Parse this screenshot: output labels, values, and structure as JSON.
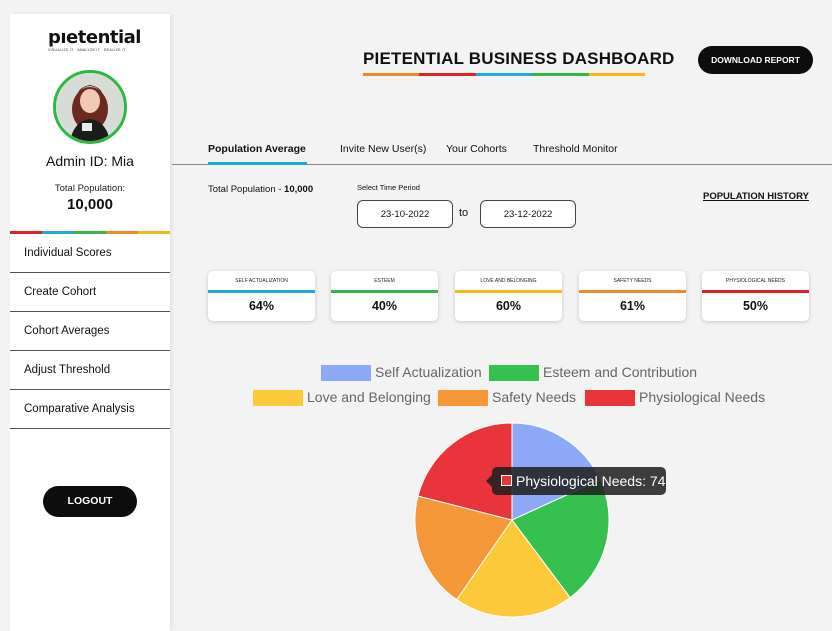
{
  "sidebar": {
    "logo": "pıetential",
    "tagline": "VISUALIZE IT · ANALYZE IT · REALIZE IT",
    "admin_id": "Admin ID: Mia",
    "total_population_label": "Total Population:",
    "total_population_value": "10,000",
    "nav": [
      "Individual Scores",
      "Create Cohort",
      "Cohort Averages",
      "Adjust Threshold",
      "Comparative Analysis"
    ],
    "logout_label": "LOGOUT"
  },
  "header": {
    "title": "PIETENTIAL BUSINESS DASHBOARD",
    "download_label": "DOWNLOAD REPORT"
  },
  "tabs": [
    "Population Average",
    "Invite New User(s)",
    "Your Cohorts",
    "Threshold Monitor"
  ],
  "filters": {
    "total_population_prefix": "Total Population - ",
    "total_population_value": "10,000",
    "time_period_label": "Select Time Period",
    "start_date": "23-10-2022",
    "to_label": "to",
    "end_date": "23-12-2022",
    "history_link": "POPULATION HISTORY"
  },
  "cards": [
    {
      "label": "SELF ACTUALIZATION",
      "value": "64%"
    },
    {
      "label": "ESTEEM",
      "value": "40%"
    },
    {
      "label": "LOVE AND BELONGING",
      "value": "60%"
    },
    {
      "label": "SAFETY NEEDS",
      "value": "61%"
    },
    {
      "label": "PHYSIOLOGICAL NEEDS",
      "value": "50%"
    }
  ],
  "colors": {
    "blue": "#23a9e1",
    "green": "#37b34a",
    "yellow": "#f7b918",
    "orange": "#f08a24",
    "red": "#e02127"
  },
  "chart_data": {
    "type": "pie",
    "legend_placement": "top",
    "series": [
      {
        "name": "Self Actualization",
        "value": 64,
        "color": "#8da8f5"
      },
      {
        "name": "Esteem and Contribution",
        "value": 76,
        "color": "#36c04f"
      },
      {
        "name": "Love and Belonging",
        "value": 70,
        "color": "#fbc93a"
      },
      {
        "name": "Safety Needs",
        "value": 68,
        "color": "#f49839"
      },
      {
        "name": "Physiological Needs",
        "value": 74,
        "color": "#e8343a"
      }
    ],
    "tooltip": {
      "text": "Physiological Needs: 74",
      "color": "#e8343a"
    }
  }
}
